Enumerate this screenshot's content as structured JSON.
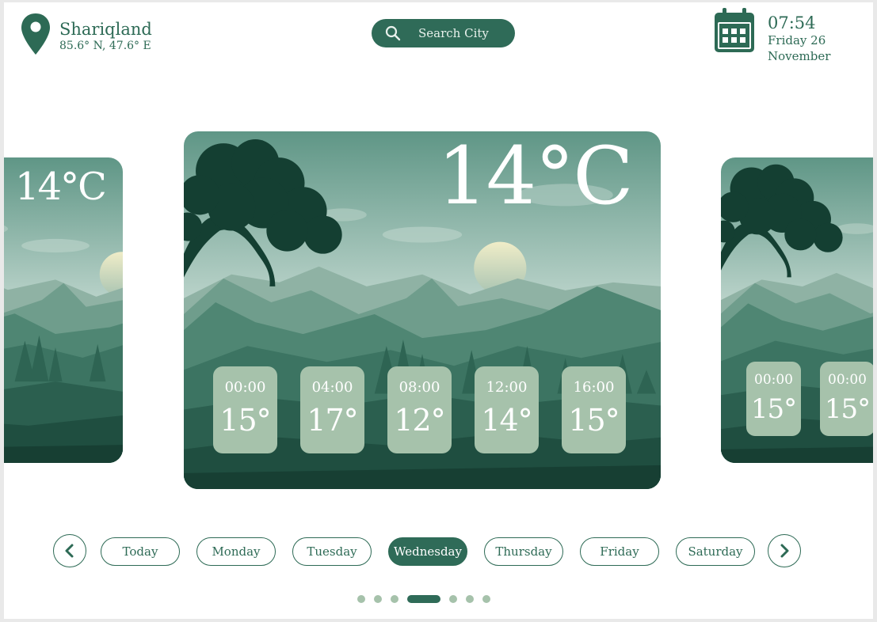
{
  "location": {
    "city": "Shariqland",
    "coords": "85.6° N, 47.6° E",
    "icon": "location-pin-icon"
  },
  "search": {
    "placeholder": "Search City",
    "icon": "search-icon"
  },
  "clock": {
    "time": "07:54",
    "day_line": "Friday 26",
    "month_line": "November",
    "icon": "calendar-icon"
  },
  "main_card": {
    "temperature": "14°C",
    "hourly": [
      {
        "time": "00:00",
        "temp": "15°"
      },
      {
        "time": "04:00",
        "temp": "17°"
      },
      {
        "time": "08:00",
        "temp": "12°"
      },
      {
        "time": "12:00",
        "temp": "14°"
      },
      {
        "time": "16:00",
        "temp": "15°"
      }
    ]
  },
  "left_card": {
    "temperature": "14°C"
  },
  "right_card": {
    "hourly": [
      {
        "time": "00:00",
        "temp": "15°"
      },
      {
        "time": "00:00",
        "temp": "15°"
      }
    ]
  },
  "days": {
    "prev_icon": "chevron-left-icon",
    "next_icon": "chevron-right-icon",
    "items": [
      "Today",
      "Monday",
      "Tuesday",
      "Wednesday",
      "Thursday",
      "Friday",
      "Saturday"
    ],
    "active": "Wednesday"
  },
  "pagination": {
    "count": 7,
    "active_index": 3
  },
  "colors": {
    "primary": "#2f6b58",
    "tile": "#a6c2ab",
    "text": "#2d6a55"
  }
}
